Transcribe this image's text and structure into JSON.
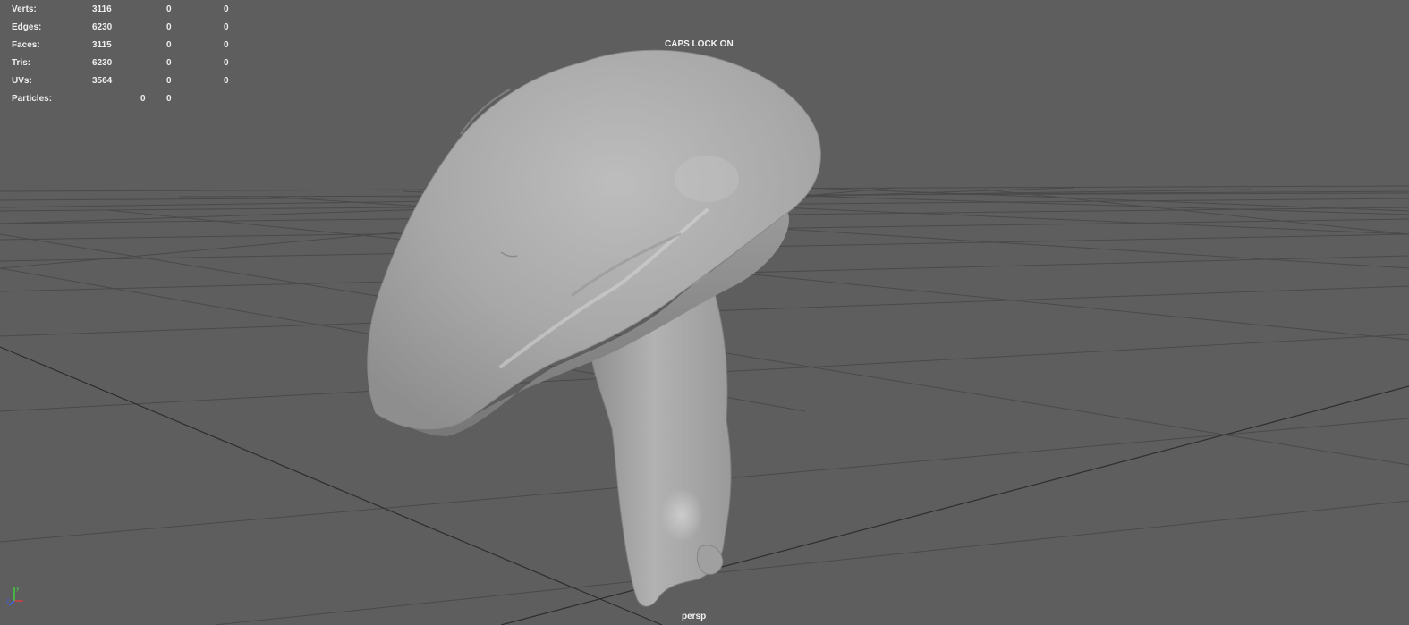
{
  "heads_up_display": {
    "rows": [
      {
        "label": "Verts:",
        "values": [
          "3116",
          "0",
          "0"
        ]
      },
      {
        "label": "Edges:",
        "values": [
          "6230",
          "0",
          "0"
        ]
      },
      {
        "label": "Faces:",
        "values": [
          "3115",
          "0",
          "0"
        ]
      },
      {
        "label": "Tris:",
        "values": [
          "6230",
          "0",
          "0"
        ]
      },
      {
        "label": "UVs:",
        "values": [
          "3564",
          "0",
          "0"
        ]
      }
    ],
    "particles": {
      "label": "Particles:",
      "values": [
        "0",
        "0"
      ]
    }
  },
  "viewport": {
    "status_message": "CAPS LOCK ON",
    "camera": "persp",
    "background_color": "#5e5e5e",
    "grid_color": "#4a4a4a",
    "grid_axis_color": "#2e2e2e",
    "model_color": "#a9a9a9",
    "model": "mushroom",
    "axis_gizmo": {
      "x_color": "#d04040",
      "y_color": "#40d040",
      "z_color": "#4060e0"
    }
  }
}
